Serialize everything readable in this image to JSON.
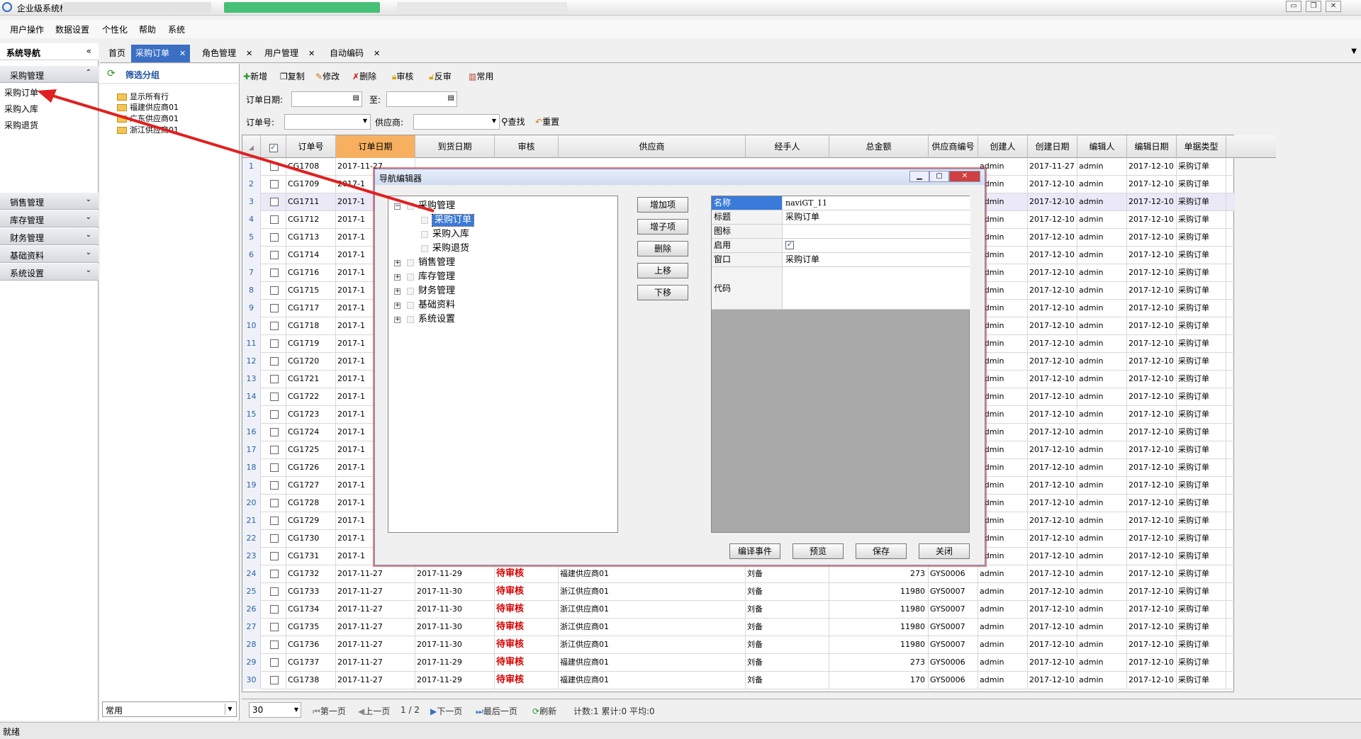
{
  "window": {
    "title": "企业级系统框架"
  },
  "menu": [
    "用户操作",
    "数据设置",
    "个性化",
    "帮助",
    "系统"
  ],
  "sidebar": {
    "title": "系统导航",
    "collapse": "«",
    "groups": [
      {
        "label": "采购管理",
        "expanded": true,
        "items": [
          "采购订单",
          "采购入库",
          "采购退货"
        ]
      },
      {
        "label": "销售管理"
      },
      {
        "label": "库存管理"
      },
      {
        "label": "财务管理"
      },
      {
        "label": "基础资料"
      },
      {
        "label": "系统设置"
      }
    ]
  },
  "tabs": [
    {
      "label": "首页"
    },
    {
      "label": "采购订单",
      "active": true
    },
    {
      "label": "角色管理"
    },
    {
      "label": "用户管理"
    },
    {
      "label": "自动编码"
    }
  ],
  "filter": {
    "title": "筛选分组",
    "nodes": [
      "显示所有行",
      "福建供应商01",
      "广东供应商01",
      "浙江供应商01"
    ],
    "combo": "常用"
  },
  "toolbar": [
    "新增",
    "复制",
    "修改",
    "删除",
    "审核",
    "反审",
    "常用"
  ],
  "query": {
    "order_date": "订单日期:",
    "to": "至:",
    "order_no": "订单号:",
    "supplier": "供应商:",
    "search": "查找",
    "reset": "重置"
  },
  "grid": {
    "headers": [
      "订单号",
      "订单日期",
      "到货日期",
      "审核",
      "供应商",
      "经手人",
      "总金额",
      "供应商编号",
      "创建人",
      "创建日期",
      "编辑人",
      "编辑日期",
      "单据类型"
    ],
    "hidden_rows": [
      {
        "n": "1",
        "no": "CG1708",
        "date": "2017-11-27",
        "ctime": "2017-11-27"
      },
      {
        "n": "2",
        "no": "CG1709",
        "date": "2017-1",
        "ctime": "2017-12-10"
      },
      {
        "n": "3",
        "no": "CG1711",
        "date": "2017-1",
        "ctime": "2017-12-10"
      },
      {
        "n": "4",
        "no": "CG1712",
        "date": "2017-1",
        "ctime": "2017-12-10"
      },
      {
        "n": "5",
        "no": "CG1713",
        "date": "2017-1",
        "ctime": "2017-12-10"
      },
      {
        "n": "6",
        "no": "CG1714",
        "date": "2017-1",
        "ctime": "2017-12-10"
      },
      {
        "n": "7",
        "no": "CG1716",
        "date": "2017-1",
        "ctime": "2017-12-10"
      },
      {
        "n": "8",
        "no": "CG1715",
        "date": "2017-1",
        "ctime": "2017-12-10"
      },
      {
        "n": "9",
        "no": "CG1717",
        "date": "2017-1",
        "ctime": "2017-12-10"
      },
      {
        "n": "10",
        "no": "CG1718",
        "date": "2017-1",
        "ctime": "2017-12-10"
      },
      {
        "n": "11",
        "no": "CG1719",
        "date": "2017-1",
        "ctime": "2017-12-10"
      },
      {
        "n": "12",
        "no": "CG1720",
        "date": "2017-1",
        "ctime": "2017-12-10"
      },
      {
        "n": "13",
        "no": "CG1721",
        "date": "2017-1",
        "ctime": "2017-12-10"
      },
      {
        "n": "14",
        "no": "CG1722",
        "date": "2017-1",
        "ctime": "2017-12-10"
      },
      {
        "n": "15",
        "no": "CG1723",
        "date": "2017-1",
        "ctime": "2017-12-10"
      },
      {
        "n": "16",
        "no": "CG1724",
        "date": "2017-1",
        "ctime": "2017-12-10"
      },
      {
        "n": "17",
        "no": "CG1725",
        "date": "2017-1",
        "ctime": "2017-12-10"
      },
      {
        "n": "18",
        "no": "CG1726",
        "date": "2017-1",
        "ctime": "2017-12-10"
      },
      {
        "n": "19",
        "no": "CG1727",
        "date": "2017-1",
        "ctime": "2017-12-10"
      },
      {
        "n": "20",
        "no": "CG1728",
        "date": "2017-1",
        "ctime": "2017-12-10"
      },
      {
        "n": "21",
        "no": "CG1729",
        "date": "2017-1",
        "ctime": "2017-12-10"
      },
      {
        "n": "22",
        "no": "CG1730",
        "date": "2017-1",
        "ctime": "2017-12-10"
      },
      {
        "n": "23",
        "no": "CG1731",
        "date": "2017-1",
        "ctime": "2017-12-10"
      }
    ],
    "full_rows": [
      {
        "n": "24",
        "no": "CG1732",
        "date": "2017-11-27",
        "arrive": "2017-11-29",
        "status": "待审核",
        "supplier": "福建供应商01",
        "handler": "刘备",
        "amount": "273",
        "scode": "GYS0006"
      },
      {
        "n": "25",
        "no": "CG1733",
        "date": "2017-11-27",
        "arrive": "2017-11-30",
        "status": "待审核",
        "supplier": "浙江供应商01",
        "handler": "刘备",
        "amount": "11980",
        "scode": "GYS0007"
      },
      {
        "n": "26",
        "no": "CG1734",
        "date": "2017-11-27",
        "arrive": "2017-11-30",
        "status": "待审核",
        "supplier": "浙江供应商01",
        "handler": "刘备",
        "amount": "11980",
        "scode": "GYS0007"
      },
      {
        "n": "27",
        "no": "CG1735",
        "date": "2017-11-27",
        "arrive": "2017-11-30",
        "status": "待审核",
        "supplier": "浙江供应商01",
        "handler": "刘备",
        "amount": "11980",
        "scode": "GYS0007"
      },
      {
        "n": "28",
        "no": "CG1736",
        "date": "2017-11-27",
        "arrive": "2017-11-30",
        "status": "待审核",
        "supplier": "浙江供应商01",
        "handler": "刘备",
        "amount": "11980",
        "scode": "GYS0007"
      },
      {
        "n": "29",
        "no": "CG1737",
        "date": "2017-11-27",
        "arrive": "2017-11-29",
        "status": "待审核",
        "supplier": "福建供应商01",
        "handler": "刘备",
        "amount": "273",
        "scode": "GYS0006"
      },
      {
        "n": "30",
        "no": "CG1738",
        "date": "2017-11-27",
        "arrive": "2017-11-29",
        "status": "待审核",
        "supplier": "福建供应商01",
        "handler": "刘备",
        "amount": "170",
        "scode": "GYS0006"
      }
    ],
    "creator": "admin",
    "editor": "admin",
    "edit_date": "2017-12-10",
    "doc_type": "采购订单"
  },
  "pager": {
    "page_size": "30",
    "first": "第一页",
    "prev": "上一页",
    "page": "1 / 2",
    "next": "下一页",
    "last": "最后一页",
    "refresh": "刷新",
    "stats": "计数:1 累计:0 平均:0"
  },
  "statusbar": "就绪",
  "dialog": {
    "title": "导航编辑器",
    "tree": [
      {
        "label": "采购管理",
        "level": 0,
        "expanded": true
      },
      {
        "label": "采购订单",
        "level": 1,
        "selected": true
      },
      {
        "label": "采购入库",
        "level": 1
      },
      {
        "label": "采购退货",
        "level": 1
      },
      {
        "label": "销售管理",
        "level": 0
      },
      {
        "label": "库存管理",
        "level": 0
      },
      {
        "label": "财务管理",
        "level": 0
      },
      {
        "label": "基础资料",
        "level": 0
      },
      {
        "label": "系统设置",
        "level": 0
      }
    ],
    "side_buttons": [
      "增加项",
      "增子项",
      "删除",
      "上移",
      "下移"
    ],
    "props": [
      {
        "key": "名称",
        "value": "naviGT_11"
      },
      {
        "key": "标题",
        "value": "采购订单"
      },
      {
        "key": "图标",
        "value": ""
      },
      {
        "key": "启用",
        "value": "✓"
      },
      {
        "key": "窗口",
        "value": "采购订单"
      },
      {
        "key": "代码",
        "value": ""
      }
    ],
    "bottom_buttons": [
      "编译事件",
      "预览",
      "保存",
      "关闭"
    ]
  },
  "colors": {
    "accent": "#3a6fc4",
    "pending": "#d40000",
    "arrow": "#e02020"
  }
}
